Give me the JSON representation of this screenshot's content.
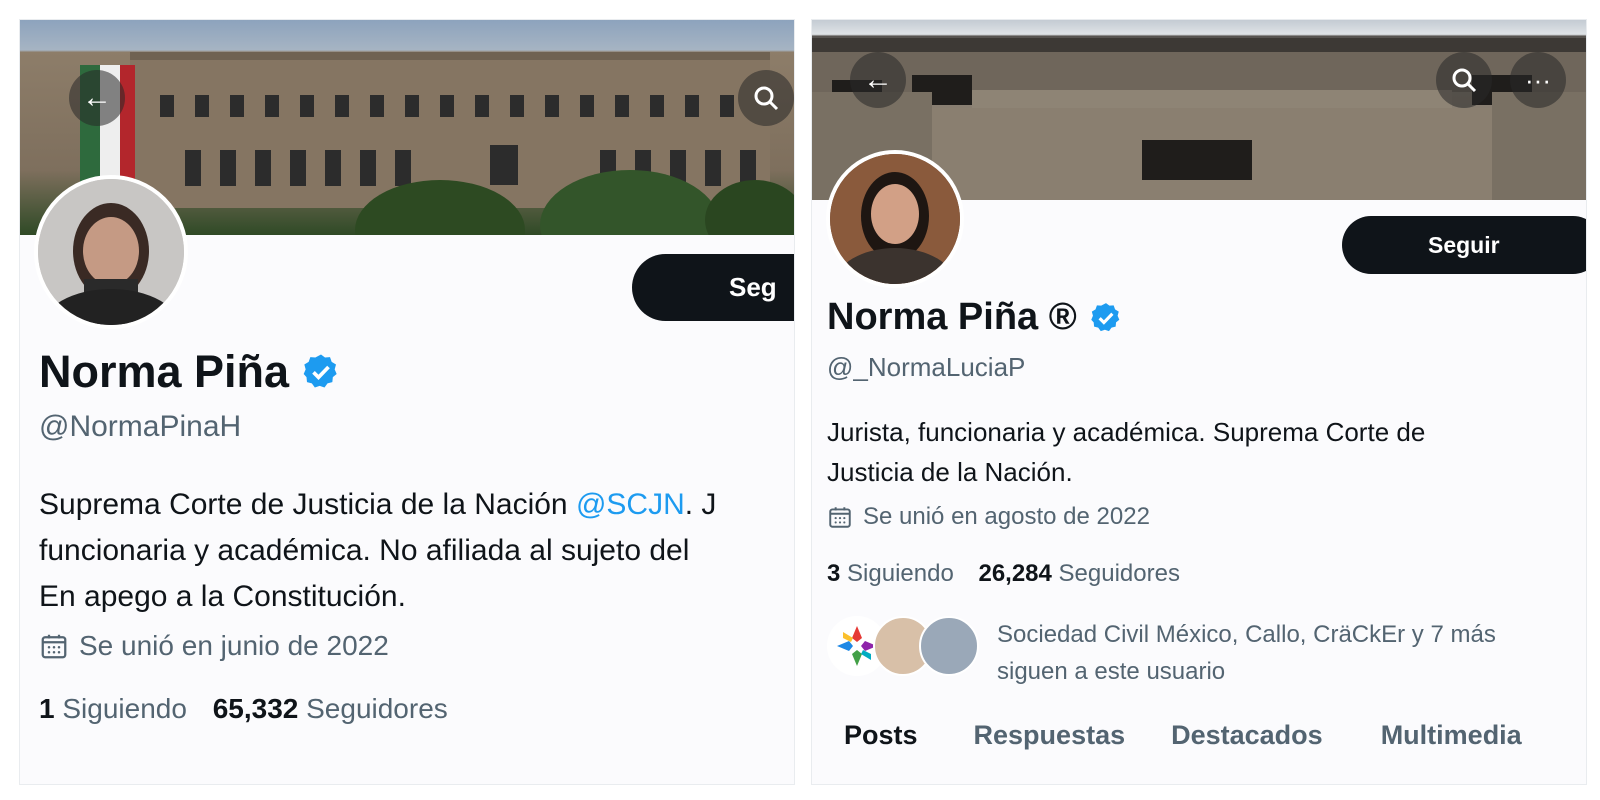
{
  "left_profile": {
    "back_icon": "arrow-left-icon",
    "search_icon": "search-icon",
    "follow_label": "Seg",
    "name": "Norma Piña",
    "verified_icon": "verified-badge-icon",
    "handle": "@NormaPinaH",
    "bio_part1": "Suprema Corte de Justicia de la Nación ",
    "bio_mention": "@SCJN",
    "bio_part2": ". J",
    "bio_line2": "funcionaria y académica. No afiliada al sujeto del",
    "bio_line3": "En apego a la Constitución.",
    "joined": "Se unió en junio de 2022",
    "following_count": "1",
    "following_label": "Siguiendo",
    "followers_count": "65,332",
    "followers_label": "Seguidores"
  },
  "right_profile": {
    "back_icon": "arrow-left-icon",
    "search_icon": "search-icon",
    "more_icon": "more-dots-icon",
    "follow_label": "Seguir",
    "name": "Norma Piña ®",
    "verified_icon": "verified-badge-icon",
    "handle": "@_NormaLuciaP",
    "bio_line1": "Jurista, funcionaria y académica. Suprema Corte de",
    "bio_line2": "Justicia de la Nación.",
    "joined": "Se unió en agosto de 2022",
    "following_count": "3",
    "following_label": "Siguiendo",
    "followers_count": "26,284",
    "followers_label": "Seguidores",
    "followed_by_line1": "Sociedad Civil México, Callo, CräCkEr y 7 más",
    "followed_by_line2": "siguen a este usuario",
    "tabs": [
      "Posts",
      "Respuestas",
      "Destacados",
      "Multimedia"
    ]
  },
  "colors": {
    "accent": "#1d9bf0",
    "text": "#0f1419",
    "secondary": "#536471",
    "button": "#0f1419"
  }
}
